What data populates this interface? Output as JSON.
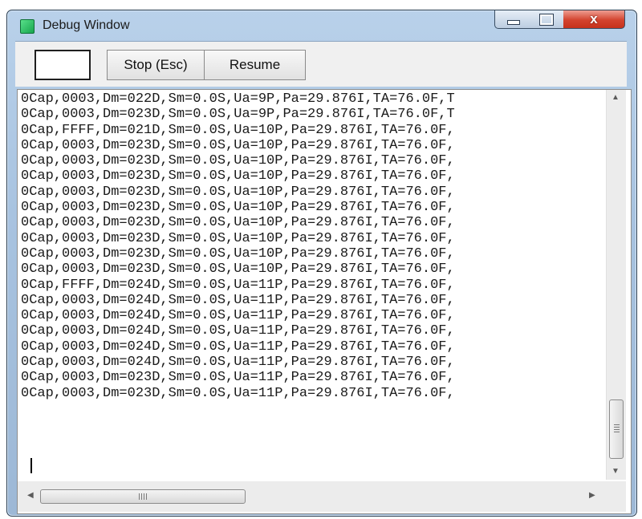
{
  "window": {
    "title": "Debug Window",
    "close_symbol": "x"
  },
  "toolbar": {
    "stop_label": "Stop (Esc)",
    "resume_label": "Resume"
  },
  "log": {
    "lines": [
      "0Cap,0003,Dm=022D,Sm=0.0S,Ua=9P,Pa=29.876I,TA=76.0F,T",
      "0Cap,0003,Dm=023D,Sm=0.0S,Ua=9P,Pa=29.876I,TA=76.0F,T",
      "0Cap,FFFF,Dm=021D,Sm=0.0S,Ua=10P,Pa=29.876I,TA=76.0F,",
      "0Cap,0003,Dm=023D,Sm=0.0S,Ua=10P,Pa=29.876I,TA=76.0F,",
      "0Cap,0003,Dm=023D,Sm=0.0S,Ua=10P,Pa=29.876I,TA=76.0F,",
      "0Cap,0003,Dm=023D,Sm=0.0S,Ua=10P,Pa=29.876I,TA=76.0F,",
      "0Cap,0003,Dm=023D,Sm=0.0S,Ua=10P,Pa=29.876I,TA=76.0F,",
      "0Cap,0003,Dm=023D,Sm=0.0S,Ua=10P,Pa=29.876I,TA=76.0F,",
      "0Cap,0003,Dm=023D,Sm=0.0S,Ua=10P,Pa=29.876I,TA=76.0F,",
      "0Cap,0003,Dm=023D,Sm=0.0S,Ua=10P,Pa=29.876I,TA=76.0F,",
      "0Cap,0003,Dm=023D,Sm=0.0S,Ua=10P,Pa=29.876I,TA=76.0F,",
      "0Cap,0003,Dm=023D,Sm=0.0S,Ua=10P,Pa=29.876I,TA=76.0F,",
      "0Cap,FFFF,Dm=024D,Sm=0.0S,Ua=11P,Pa=29.876I,TA=76.0F,",
      "0Cap,0003,Dm=024D,Sm=0.0S,Ua=11P,Pa=29.876I,TA=76.0F,",
      "0Cap,0003,Dm=024D,Sm=0.0S,Ua=11P,Pa=29.876I,TA=76.0F,",
      "0Cap,0003,Dm=024D,Sm=0.0S,Ua=11P,Pa=29.876I,TA=76.0F,",
      "0Cap,0003,Dm=024D,Sm=0.0S,Ua=11P,Pa=29.876I,TA=76.0F,",
      "0Cap,0003,Dm=024D,Sm=0.0S,Ua=11P,Pa=29.876I,TA=76.0F,",
      "0Cap,0003,Dm=023D,Sm=0.0S,Ua=11P,Pa=29.876I,TA=76.0F,",
      "0Cap,0003,Dm=023D,Sm=0.0S,Ua=11P,Pa=29.876I,TA=76.0F,"
    ]
  },
  "scrollbars": {
    "horizontal_grip_symbol": "III"
  }
}
